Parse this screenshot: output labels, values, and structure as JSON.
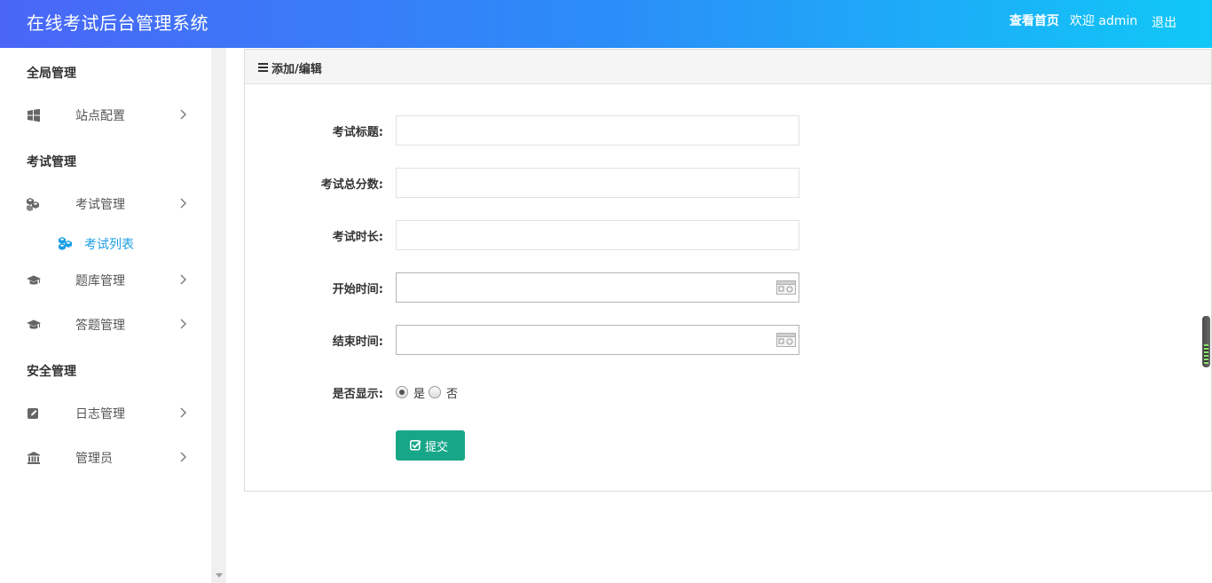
{
  "app": {
    "title": "在线考试后台管理系统"
  },
  "header": {
    "home_link": "查看首页",
    "welcome": "欢迎 admin",
    "logout": "退出"
  },
  "sidebar": {
    "groups": [
      {
        "title": "全局管理"
      },
      {
        "title": "考试管理"
      },
      {
        "title": "安全管理"
      }
    ],
    "items": [
      {
        "label": "站点配置",
        "icon": "windows-icon"
      },
      {
        "label": "考试管理",
        "icon": "cubes-icon"
      },
      {
        "label": "考试列表",
        "icon": "cubes-icon",
        "active": true
      },
      {
        "label": "题库管理",
        "icon": "graduation-cap-icon"
      },
      {
        "label": "答题管理",
        "icon": "graduation-cap-icon"
      },
      {
        "label": "日志管理",
        "icon": "edit-icon"
      },
      {
        "label": "管理员",
        "icon": "bank-icon"
      }
    ]
  },
  "panel": {
    "title": "添加/编辑",
    "fields": [
      {
        "label": "考试标题:",
        "value": ""
      },
      {
        "label": "考试总分数:",
        "value": ""
      },
      {
        "label": "考试时长:",
        "value": ""
      },
      {
        "label": "开始时间:",
        "value": ""
      },
      {
        "label": "结束时间:",
        "value": ""
      }
    ],
    "display": {
      "label": "是否显示:",
      "options": [
        "是",
        "否"
      ],
      "selected": "是"
    },
    "submit_label": "提交"
  },
  "colors": {
    "header_gradient_start": "#4a66f7",
    "header_gradient_end": "#10c8f7",
    "submit_button": "#18a689",
    "active_sidebar_item": "#1a9ee5"
  }
}
